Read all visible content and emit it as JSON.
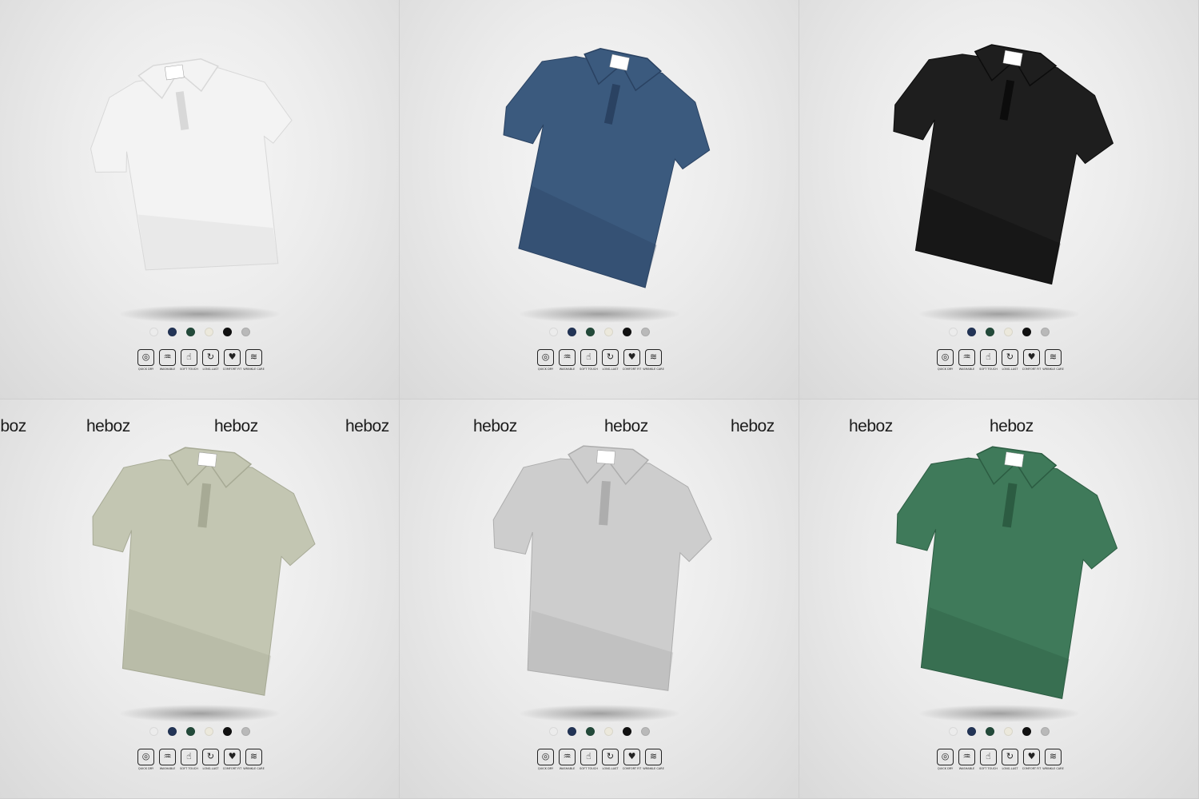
{
  "brand": "heboz",
  "swatch_colors": [
    "#ececec",
    "#223456",
    "#234a3a",
    "#ece9dc",
    "#111111",
    "#b9b9b9"
  ],
  "features": [
    {
      "label": "QUICK DRY",
      "icon": "quick-dry-icon",
      "glyph": "◎"
    },
    {
      "label": "WASHABLE",
      "icon": "washable-icon",
      "glyph": "♒"
    },
    {
      "label": "SOFT TOUCH",
      "icon": "soft-touch-icon",
      "glyph": "☝"
    },
    {
      "label": "LONG-LAST",
      "icon": "long-last-icon",
      "glyph": "↻"
    },
    {
      "label": "COMFORT FIT",
      "icon": "comfort-fit-icon",
      "glyph": "♥"
    },
    {
      "label": "WRINKLE CARE",
      "icon": "wrinkle-care-icon",
      "glyph": "≋"
    }
  ],
  "shirts": [
    {
      "name": "white",
      "color": "#f3f3f3",
      "shade": "#d8d8d8"
    },
    {
      "name": "navy",
      "color": "#3b5a7e",
      "shade": "#2a4262"
    },
    {
      "name": "black",
      "color": "#1e1e1e",
      "shade": "#0c0c0c"
    },
    {
      "name": "sage",
      "color": "#c3c6b2",
      "shade": "#a7aa95"
    },
    {
      "name": "grey",
      "color": "#cdcdcd",
      "shade": "#adadad"
    },
    {
      "name": "green",
      "color": "#3f7a5a",
      "shade": "#2c5c42"
    }
  ]
}
